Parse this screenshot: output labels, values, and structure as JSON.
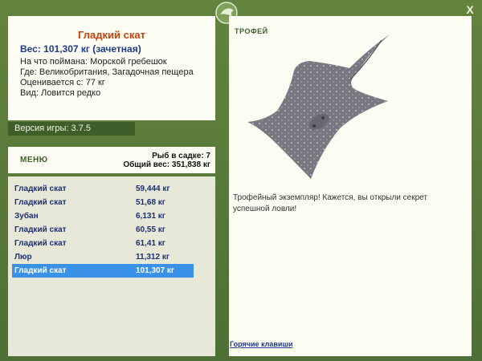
{
  "fish": {
    "name": "Гладкий скат",
    "weight_line": "Вес: 101,307 кг (зачетная)",
    "caught_on": "На что поймана: Морской гребешок",
    "location": "Где: Великобритания, Загадочная пещера",
    "valued_from": "Оценивается с: 77 кг",
    "kind": "Вид: Ловится редко"
  },
  "version": "Версия игры: 3.7.5",
  "menu_label": "МЕНЮ",
  "keepnet": {
    "count_line": "Рыб в садке: 7",
    "total_line": "Общий вес: 351,838 кг"
  },
  "catches": [
    {
      "name": "Гладкий скат",
      "weight": "59,444 кг"
    },
    {
      "name": "Гладкий скат",
      "weight": "51,68 кг"
    },
    {
      "name": "Зубан",
      "weight": "6,131 кг"
    },
    {
      "name": "Гладкий скат",
      "weight": "60,55 кг"
    },
    {
      "name": "Гладкий скат",
      "weight": "61,41 кг"
    },
    {
      "name": "Люр",
      "weight": "11,312 кг"
    },
    {
      "name": "Гладкий скат",
      "weight": "101,307 кг"
    }
  ],
  "selected_index": 6,
  "trophy": {
    "label": "ТРОФЕЙ",
    "description": "Трофейный экземпляр! Кажется, вы открыли секрет успешной ловли!"
  },
  "hotkeys_link": "Горячие клавиши",
  "close_label": "X",
  "icons": {
    "close": "close-icon",
    "logo": "fish-logo-icon",
    "trophy_image": "stingray-illustration"
  },
  "colors": {
    "frame": "#5b7b3f",
    "panel": "#fcfcf2",
    "title": "#c2410c",
    "link": "#1e3a8a",
    "selection": "#3a92e8"
  }
}
